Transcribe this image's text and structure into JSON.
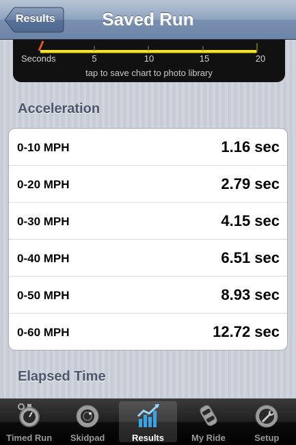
{
  "nav": {
    "back_label": "Results",
    "title": "Saved Run"
  },
  "chart": {
    "x_axis_title": "Seconds",
    "ticks": [
      "5",
      "10",
      "15",
      "20"
    ],
    "hint": "tap to save chart to photo library",
    "line_color": "#f5e61e"
  },
  "acceleration": {
    "header": "Acceleration",
    "rows": [
      {
        "label": "0-10 MPH",
        "value": "1.16 sec"
      },
      {
        "label": "0-20 MPH",
        "value": "2.79 sec"
      },
      {
        "label": "0-30 MPH",
        "value": "4.15 sec"
      },
      {
        "label": "0-40 MPH",
        "value": "6.51 sec"
      },
      {
        "label": "0-50 MPH",
        "value": "8.93 sec"
      },
      {
        "label": "0-60 MPH",
        "value": "12.72 sec"
      }
    ]
  },
  "elapsed": {
    "header": "Elapsed Time"
  },
  "tabs": [
    {
      "label": "Timed Run",
      "icon": "stopwatch-icon",
      "active": false
    },
    {
      "label": "Skidpad",
      "icon": "skidpad-icon",
      "active": false
    },
    {
      "label": "Results",
      "icon": "results-chart-icon",
      "active": true
    },
    {
      "label": "My Ride",
      "icon": "car-icon",
      "active": false
    },
    {
      "label": "Setup",
      "icon": "wrench-gear-icon",
      "active": false
    }
  ]
}
